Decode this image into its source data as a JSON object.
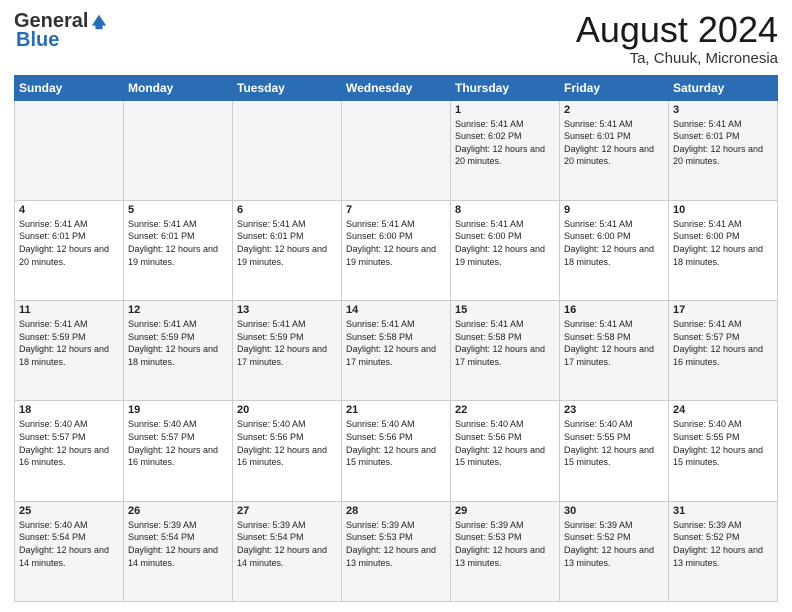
{
  "header": {
    "logo_general": "General",
    "logo_blue": "Blue",
    "title": "August 2024",
    "subtitle": "Ta, Chuuk, Micronesia"
  },
  "weekdays": [
    "Sunday",
    "Monday",
    "Tuesday",
    "Wednesday",
    "Thursday",
    "Friday",
    "Saturday"
  ],
  "rows": [
    [
      {
        "day": "",
        "info": ""
      },
      {
        "day": "",
        "info": ""
      },
      {
        "day": "",
        "info": ""
      },
      {
        "day": "",
        "info": ""
      },
      {
        "day": "1",
        "info": "Sunrise: 5:41 AM\nSunset: 6:02 PM\nDaylight: 12 hours\nand 20 minutes."
      },
      {
        "day": "2",
        "info": "Sunrise: 5:41 AM\nSunset: 6:01 PM\nDaylight: 12 hours\nand 20 minutes."
      },
      {
        "day": "3",
        "info": "Sunrise: 5:41 AM\nSunset: 6:01 PM\nDaylight: 12 hours\nand 20 minutes."
      }
    ],
    [
      {
        "day": "4",
        "info": "Sunrise: 5:41 AM\nSunset: 6:01 PM\nDaylight: 12 hours\nand 20 minutes."
      },
      {
        "day": "5",
        "info": "Sunrise: 5:41 AM\nSunset: 6:01 PM\nDaylight: 12 hours\nand 19 minutes."
      },
      {
        "day": "6",
        "info": "Sunrise: 5:41 AM\nSunset: 6:01 PM\nDaylight: 12 hours\nand 19 minutes."
      },
      {
        "day": "7",
        "info": "Sunrise: 5:41 AM\nSunset: 6:00 PM\nDaylight: 12 hours\nand 19 minutes."
      },
      {
        "day": "8",
        "info": "Sunrise: 5:41 AM\nSunset: 6:00 PM\nDaylight: 12 hours\nand 19 minutes."
      },
      {
        "day": "9",
        "info": "Sunrise: 5:41 AM\nSunset: 6:00 PM\nDaylight: 12 hours\nand 18 minutes."
      },
      {
        "day": "10",
        "info": "Sunrise: 5:41 AM\nSunset: 6:00 PM\nDaylight: 12 hours\nand 18 minutes."
      }
    ],
    [
      {
        "day": "11",
        "info": "Sunrise: 5:41 AM\nSunset: 5:59 PM\nDaylight: 12 hours\nand 18 minutes."
      },
      {
        "day": "12",
        "info": "Sunrise: 5:41 AM\nSunset: 5:59 PM\nDaylight: 12 hours\nand 18 minutes."
      },
      {
        "day": "13",
        "info": "Sunrise: 5:41 AM\nSunset: 5:59 PM\nDaylight: 12 hours\nand 17 minutes."
      },
      {
        "day": "14",
        "info": "Sunrise: 5:41 AM\nSunset: 5:58 PM\nDaylight: 12 hours\nand 17 minutes."
      },
      {
        "day": "15",
        "info": "Sunrise: 5:41 AM\nSunset: 5:58 PM\nDaylight: 12 hours\nand 17 minutes."
      },
      {
        "day": "16",
        "info": "Sunrise: 5:41 AM\nSunset: 5:58 PM\nDaylight: 12 hours\nand 17 minutes."
      },
      {
        "day": "17",
        "info": "Sunrise: 5:41 AM\nSunset: 5:57 PM\nDaylight: 12 hours\nand 16 minutes."
      }
    ],
    [
      {
        "day": "18",
        "info": "Sunrise: 5:40 AM\nSunset: 5:57 PM\nDaylight: 12 hours\nand 16 minutes."
      },
      {
        "day": "19",
        "info": "Sunrise: 5:40 AM\nSunset: 5:57 PM\nDaylight: 12 hours\nand 16 minutes."
      },
      {
        "day": "20",
        "info": "Sunrise: 5:40 AM\nSunset: 5:56 PM\nDaylight: 12 hours\nand 16 minutes."
      },
      {
        "day": "21",
        "info": "Sunrise: 5:40 AM\nSunset: 5:56 PM\nDaylight: 12 hours\nand 15 minutes."
      },
      {
        "day": "22",
        "info": "Sunrise: 5:40 AM\nSunset: 5:56 PM\nDaylight: 12 hours\nand 15 minutes."
      },
      {
        "day": "23",
        "info": "Sunrise: 5:40 AM\nSunset: 5:55 PM\nDaylight: 12 hours\nand 15 minutes."
      },
      {
        "day": "24",
        "info": "Sunrise: 5:40 AM\nSunset: 5:55 PM\nDaylight: 12 hours\nand 15 minutes."
      }
    ],
    [
      {
        "day": "25",
        "info": "Sunrise: 5:40 AM\nSunset: 5:54 PM\nDaylight: 12 hours\nand 14 minutes."
      },
      {
        "day": "26",
        "info": "Sunrise: 5:39 AM\nSunset: 5:54 PM\nDaylight: 12 hours\nand 14 minutes."
      },
      {
        "day": "27",
        "info": "Sunrise: 5:39 AM\nSunset: 5:54 PM\nDaylight: 12 hours\nand 14 minutes."
      },
      {
        "day": "28",
        "info": "Sunrise: 5:39 AM\nSunset: 5:53 PM\nDaylight: 12 hours\nand 13 minutes."
      },
      {
        "day": "29",
        "info": "Sunrise: 5:39 AM\nSunset: 5:53 PM\nDaylight: 12 hours\nand 13 minutes."
      },
      {
        "day": "30",
        "info": "Sunrise: 5:39 AM\nSunset: 5:52 PM\nDaylight: 12 hours\nand 13 minutes."
      },
      {
        "day": "31",
        "info": "Sunrise: 5:39 AM\nSunset: 5:52 PM\nDaylight: 12 hours\nand 13 minutes."
      }
    ]
  ]
}
